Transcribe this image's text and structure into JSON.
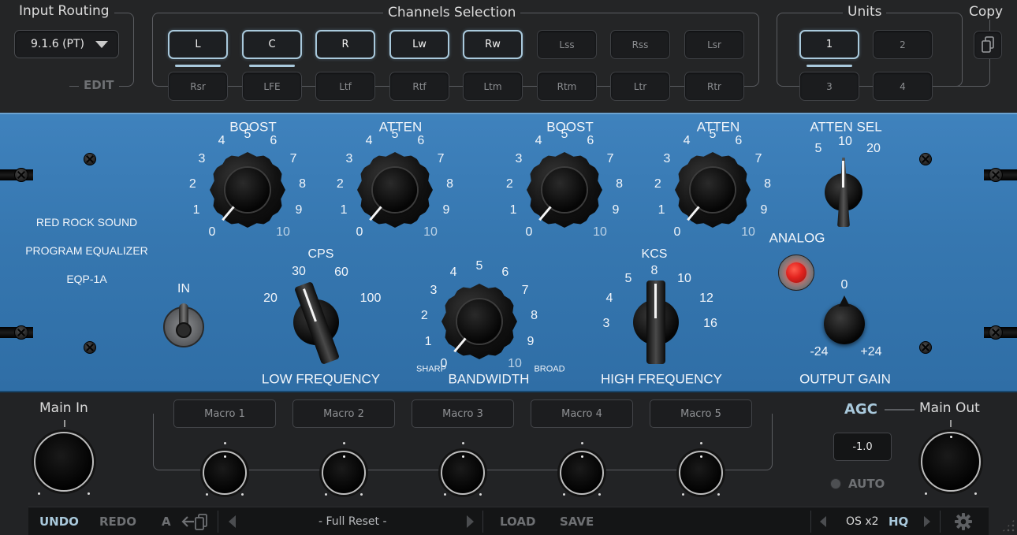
{
  "input_routing": {
    "title": "Input Routing",
    "value": "9.1.6 (PT)",
    "edit_label": "EDIT"
  },
  "channels": {
    "title": "Channels Selection",
    "row1": [
      "L",
      "C",
      "R",
      "Lw",
      "Rw",
      "Lss",
      "Rss",
      "Lsr"
    ],
    "row2": [
      "Rsr",
      "LFE",
      "Ltf",
      "Rtf",
      "Ltm",
      "Rtm",
      "Ltr",
      "Rtr"
    ],
    "active": [
      "L",
      "C",
      "R",
      "Lw",
      "Rw"
    ]
  },
  "units": {
    "title": "Units",
    "items": [
      "1",
      "2",
      "3",
      "4"
    ],
    "active": "1"
  },
  "copy": {
    "title": "Copy"
  },
  "plate": {
    "brand": [
      "RED ROCK SOUND",
      "PROGRAM EQUALIZER",
      "EQP-1A"
    ],
    "low_boost": {
      "title": "BOOST",
      "value": 0
    },
    "low_atten": {
      "title": "ATTEN",
      "value": 0
    },
    "high_boost": {
      "title": "BOOST",
      "value": 0
    },
    "high_atten": {
      "title": "ATTEN",
      "value": 0
    },
    "dial_marks": [
      "0",
      "1",
      "2",
      "3",
      "4",
      "5",
      "6",
      "7",
      "8",
      "9",
      "10"
    ],
    "atten_sel": {
      "title": "ATTEN SEL",
      "options": [
        "5",
        "10",
        "20"
      ],
      "selected": "10"
    },
    "in_label": "IN",
    "cps": {
      "title": "CPS",
      "options": [
        "20",
        "30",
        "60",
        "100"
      ],
      "selected": "30",
      "label": "LOW FREQUENCY"
    },
    "bandwidth": {
      "label": "BANDWIDTH",
      "sharp": "SHARP",
      "broad": "BROAD",
      "value": 0
    },
    "kcs": {
      "title": "KCS",
      "options": [
        "3",
        "4",
        "5",
        "8",
        "10",
        "12",
        "16"
      ],
      "selected": "8",
      "label": "HIGH FREQUENCY"
    },
    "analog": {
      "label": "ANALOG",
      "on": true,
      "color": "#e3241f"
    },
    "output_gain": {
      "label": "OUTPUT GAIN",
      "min": "-24",
      "max": "+24",
      "center": "0",
      "value": 0
    }
  },
  "bottom": {
    "main_in": {
      "label": "Main In"
    },
    "macros": [
      "Macro 1",
      "Macro 2",
      "Macro 3",
      "Macro 4",
      "Macro 5"
    ],
    "agc": {
      "label": "AGC",
      "value": "-1.0",
      "auto": "AUTO"
    },
    "main_out": {
      "label": "Main Out"
    }
  },
  "toolbar": {
    "undo": "UNDO",
    "redo": "REDO",
    "ab": "A",
    "preset": "- Full Reset -",
    "load": "LOAD",
    "save": "SAVE",
    "os": "OS x2",
    "hq": "HQ"
  },
  "colors": {
    "accent": "#a9c9dc",
    "plate": "#3677b0",
    "analog_led": "#e3241f"
  }
}
